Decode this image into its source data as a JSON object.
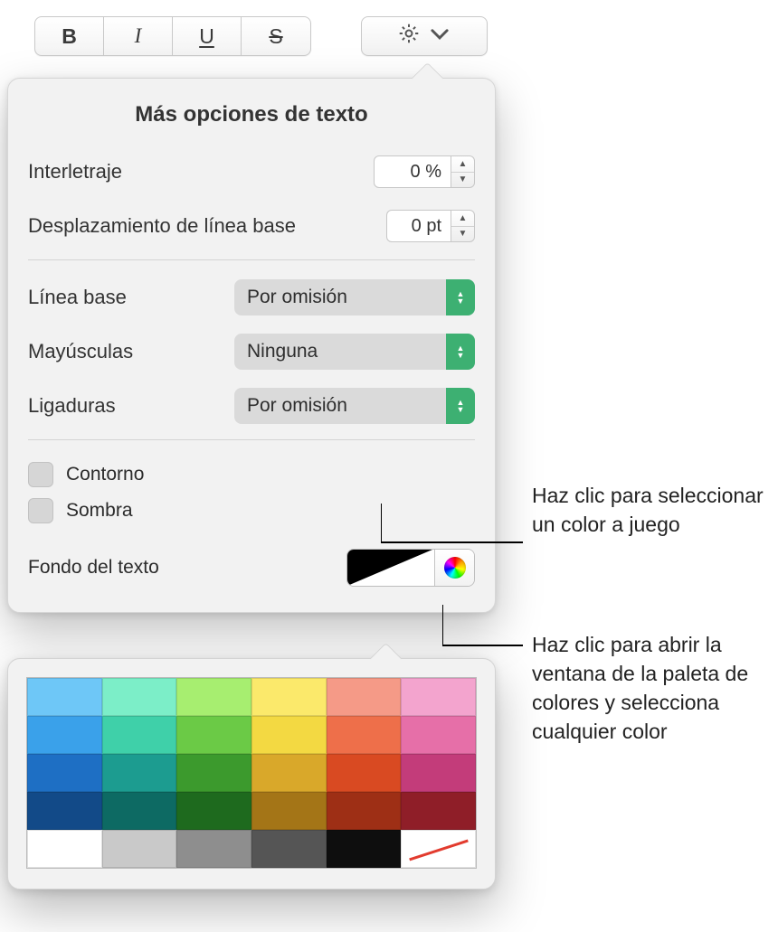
{
  "toolbar": {
    "bold_glyph": "B",
    "italic_glyph": "I",
    "underline_glyph": "U",
    "strike_glyph": "S"
  },
  "panel": {
    "title": "Más opciones de texto",
    "tracking_label": "Interletraje",
    "tracking_value": "0 %",
    "baseline_shift_label": "Desplazamiento de línea base",
    "baseline_shift_value": "0 pt",
    "baseline_label": "Línea base",
    "baseline_value": "Por omisión",
    "caps_label": "Mayúsculas",
    "caps_value": "Ninguna",
    "ligatures_label": "Ligaduras",
    "ligatures_value": "Por omisión",
    "outline_label": "Contorno",
    "shadow_label": "Sombra",
    "text_bg_label": "Fondo del texto"
  },
  "callouts": {
    "swatch": "Haz clic para seleccionar un color a juego",
    "wheel": "Haz clic para abrir la ventana de la paleta de colores y selecciona cualquier color"
  },
  "palette": {
    "rows": [
      [
        "#6ec7f7",
        "#7ceec8",
        "#a7ee70",
        "#fbe96b",
        "#f59a87",
        "#f3a4ce"
      ],
      [
        "#3aa1ea",
        "#3fd0a9",
        "#6bca46",
        "#f3d942",
        "#ee6f4a",
        "#e66fa8"
      ],
      [
        "#1e6fc4",
        "#1c9c90",
        "#3c9a2d",
        "#d9a82a",
        "#d94a22",
        "#c33c7a"
      ],
      [
        "#124a88",
        "#0d6a63",
        "#1e6a1e",
        "#a47517",
        "#9e2f15",
        "#8f1e28"
      ],
      [
        "#ffffff",
        "#c9c9c9",
        "#8e8e8e",
        "#555555",
        "#0e0e0e",
        "none"
      ]
    ]
  }
}
